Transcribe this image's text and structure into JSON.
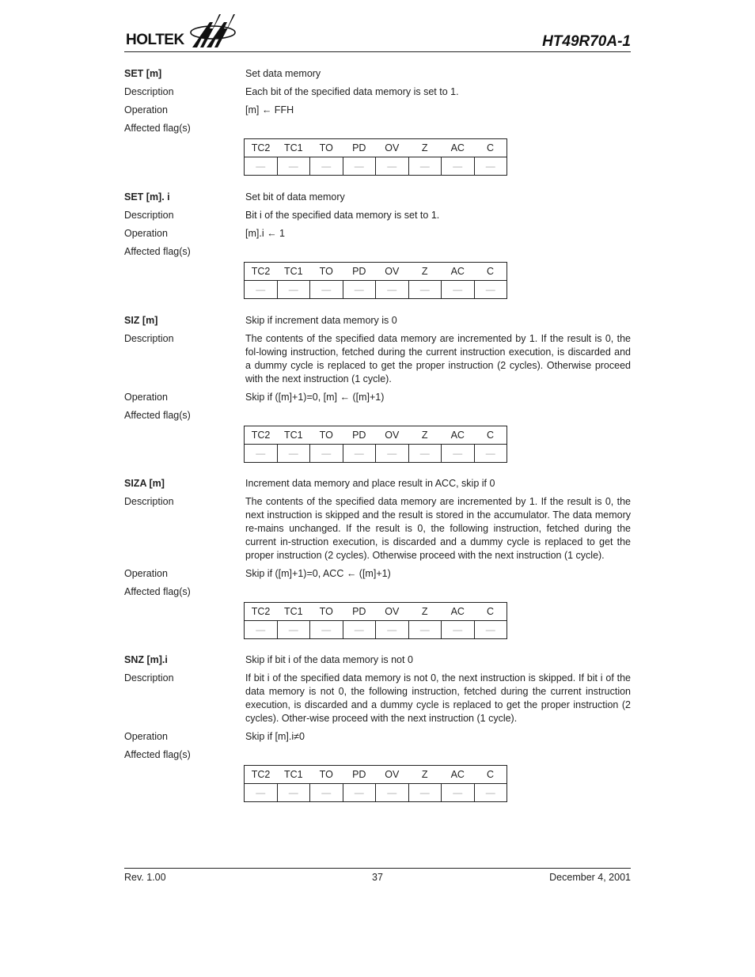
{
  "header": {
    "logo_text": "HOLTEK",
    "doc_title": "HT49R70A-1"
  },
  "labels": {
    "description": "Description",
    "operation": "Operation",
    "affected_flags": "Affected flag(s)"
  },
  "flag_headers": [
    "TC2",
    "TC1",
    "TO",
    "PD",
    "OV",
    "Z",
    "AC",
    "C"
  ],
  "instructions": [
    {
      "mnemonic": "SET [m]",
      "summary": "Set data memory",
      "description": "Each bit of the specified data memory is set to 1.",
      "operation": "[m] ← FFH",
      "flags": [
        "—",
        "—",
        "—",
        "—",
        "—",
        "—",
        "—",
        "—"
      ]
    },
    {
      "mnemonic": "SET [m]. i",
      "summary": "Set bit of data memory",
      "description": "Bit i of the specified data memory is set to 1.",
      "operation": "[m].i ← 1",
      "flags": [
        "—",
        "—",
        "—",
        "—",
        "—",
        "—",
        "—",
        "—"
      ]
    },
    {
      "mnemonic": "SIZ [m]",
      "summary": "Skip if increment data memory is 0",
      "description": "The contents of the specified data memory are incremented by 1. If the result is 0, the fol-lowing instruction, fetched during the current instruction execution, is discarded and a dummy cycle is replaced to get the proper instruction (2 cycles). Otherwise proceed with the next instruction (1 cycle).",
      "operation": "Skip if ([m]+1)=0, [m] ← ([m]+1)",
      "flags": [
        "—",
        "—",
        "—",
        "—",
        "—",
        "—",
        "—",
        "—"
      ]
    },
    {
      "mnemonic": "SIZA [m]",
      "summary": "Increment data memory and place result in ACC, skip if 0",
      "description": "The contents of the specified data memory are incremented by 1. If the result is 0, the next instruction is skipped and the result is stored in the accumulator. The data memory re-mains unchanged. If the result is 0, the following instruction, fetched during the current in-struction execution, is discarded and a dummy cycle is replaced to get the proper instruction (2 cycles). Otherwise proceed with the next instruction (1 cycle).",
      "operation": "Skip if ([m]+1)=0, ACC ← ([m]+1)",
      "flags": [
        "—",
        "—",
        "—",
        "—",
        "—",
        "—",
        "—",
        "—"
      ]
    },
    {
      "mnemonic": "SNZ [m].i",
      "summary": "Skip if bit i of the data memory is not 0",
      "description": "If bit i of the specified data memory is not 0, the next instruction is skipped. If bit i of the data memory is not 0, the following instruction, fetched during the current instruction execution, is discarded and a dummy cycle is replaced to get the proper instruction (2 cycles). Other-wise proceed with the next instruction (1 cycle).",
      "operation": "Skip if [m].i≠0",
      "flags": [
        "—",
        "—",
        "—",
        "—",
        "—",
        "—",
        "—",
        "—"
      ]
    }
  ],
  "footer": {
    "revision": "Rev. 1.00",
    "page_number": "37",
    "date": "December 4, 2001"
  }
}
